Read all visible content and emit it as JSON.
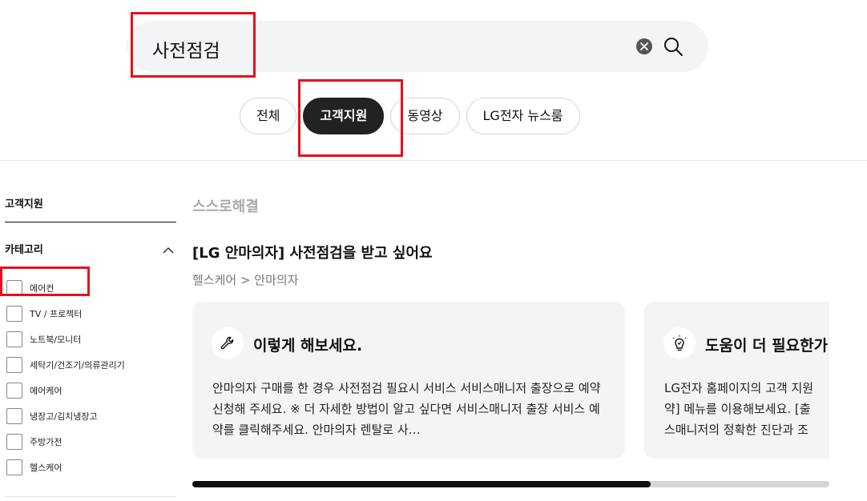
{
  "search": {
    "query": "사전점검"
  },
  "tabs": [
    {
      "label": "전체",
      "active": false
    },
    {
      "label": "고객지원",
      "active": true
    },
    {
      "label": "동영상",
      "active": false
    },
    {
      "label": "LG전자 뉴스룸",
      "active": false
    }
  ],
  "sidebar": {
    "title": "고객지원",
    "category_title": "카테고리",
    "categories": [
      "에어컨",
      "TV / 프로젝터",
      "노트북/모니터",
      "세탁기/건조기/의류관리기",
      "에어케어",
      "냉장고/김치냉장고",
      "주방가전",
      "헬스케어"
    ]
  },
  "main": {
    "section_title": "스스로해결",
    "result_title": "[LG 안마의자] 사전점검을 받고 싶어요",
    "result_path": "헬스케어 > 안마의자",
    "cards": [
      {
        "icon": "wrench-icon",
        "heading": "이렇게 해보세요.",
        "body": "안마의자 구매를 한 경우 사전점검 필요시 서비스 서비스매니저 출장으로 예약 신청해 주세요. ※ 더 자세한 방법이 알고 싶다면 서비스매니저 출장 서비스 예약를 클릭해주세요. 안마의자 렌탈로 사…"
      },
      {
        "icon": "lightbulb-icon",
        "heading": "도움이 더 필요한가",
        "body_lines": [
          "LG전자 홈페이지의 고객 지원",
          "약] 메뉴를 이용해보세요. [출",
          "스매니저의 정확한 진단과 조"
        ]
      }
    ]
  },
  "colors": {
    "highlight": "#e5101c",
    "active_tab": "#222222",
    "card_bg": "#f3f4f5"
  }
}
